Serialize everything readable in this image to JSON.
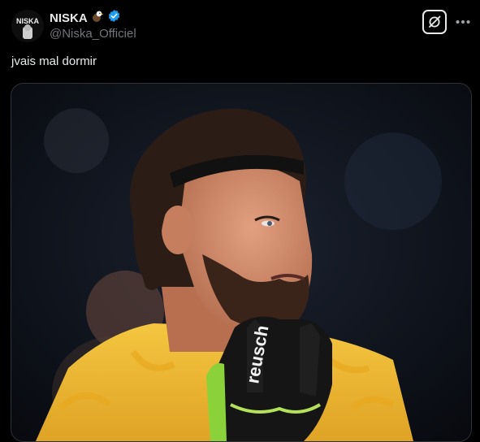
{
  "author": {
    "display_name": "NISKA",
    "handle": "@Niska_Officiel",
    "avatar_text": "NISKA",
    "emoji": "eagle-emoji",
    "verified_badge": "verified-badge-icon"
  },
  "actions": {
    "grok_icon": "grok-icon",
    "more_icon": "more-icon"
  },
  "tweet": {
    "text": "jvais mal dormir"
  },
  "media": {
    "glove_brand": "reusch"
  },
  "colors": {
    "background": "#000000",
    "text": "#e7e9ea",
    "secondary": "#71767b",
    "verified": "#1d9bf0"
  }
}
